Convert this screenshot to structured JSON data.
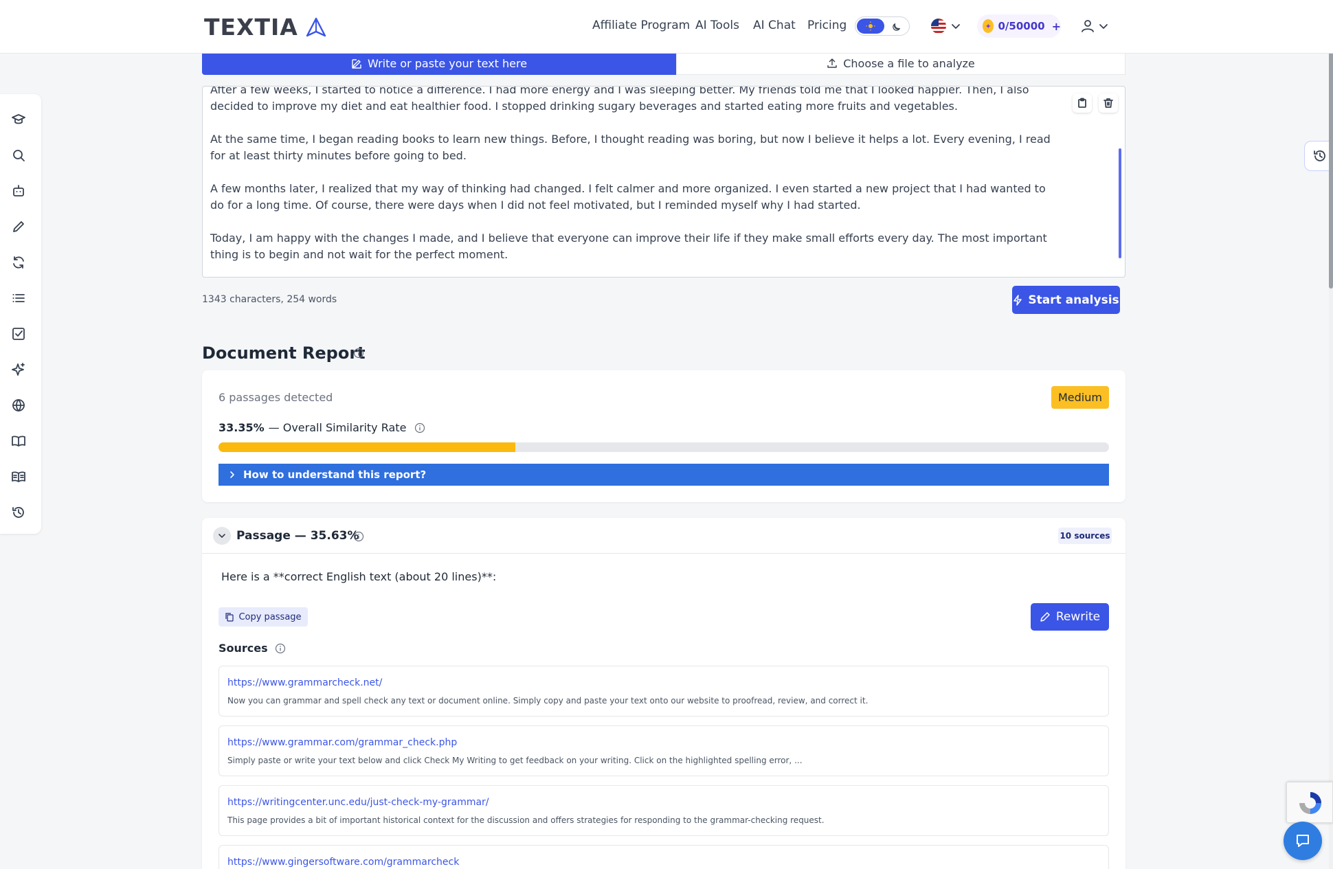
{
  "header": {
    "logo": "TEXTIA",
    "nav": [
      "Affiliate Program",
      "AI Tools",
      "AI Chat",
      "Pricing"
    ],
    "credits": "0/50000",
    "credits_plus": "+"
  },
  "input_tabs": {
    "write": "Write or paste your text here",
    "file": "Choose a file to analyze"
  },
  "editor": {
    "text": "After a few weeks, I started to notice a difference. I had more energy and I was sleeping better. My friends told me that I looked happier. Then, I also decided to improve my diet and eat healthier food. I stopped drinking sugary beverages and started eating more fruits and vegetables.\n\nAt the same time, I began reading books to learn new things. Before, I thought reading was boring, but now I believe it helps a lot. Every evening, I read for at least thirty minutes before going to bed.\n\nA few months later, I realized that my way of thinking had changed. I felt calmer and more organized. I even started a new project that I had wanted to do for a long time. Of course, there were days when I did not feel motivated, but I reminded myself why I had started.\n\nToday, I am happy with the changes I made, and I believe that everyone can improve their life if they make small efforts every day. The most important thing is to begin and not wait for the perfect moment."
  },
  "stats": "1343 characters, 254 words",
  "start_button": "Start analysis",
  "report": {
    "title": "Document Report",
    "passages": "6 passages detected",
    "level": "Medium",
    "rate_value": "33.35%",
    "rate_label": "— Overall Similarity Rate",
    "rate_fraction": 0.3335,
    "understand": "How to understand this report?"
  },
  "passage": {
    "title": "Passage — 35.63%",
    "sources_count": "10 sources",
    "text": "Here is a **correct English text (about 20 lines)**:",
    "copy": "Copy passage",
    "rewrite": "Rewrite",
    "sources_title": "Sources",
    "sources": [
      {
        "url": "https://www.grammarcheck.net/",
        "desc": "Now you can grammar and spell check any text or document online. Simply copy and paste your text onto our website to proofread, review, and correct it."
      },
      {
        "url": "https://www.grammar.com/grammar_check.php",
        "desc": "Simply paste or write your text below and click Check My Writing to get feedback on your writing. Click on the highlighted spelling error, ..."
      },
      {
        "url": "https://writingcenter.unc.edu/just-check-my-grammar/",
        "desc": "This page provides a bit of important historical context for the discussion and offers strategies for responding to the grammar-checking request."
      },
      {
        "url": "https://www.gingersoftware.com/grammarcheck",
        "desc": ""
      }
    ]
  },
  "colors": {
    "primary": "#3b55e6",
    "medium": "#fbbf24",
    "understand_bar": "#2f6fde"
  }
}
